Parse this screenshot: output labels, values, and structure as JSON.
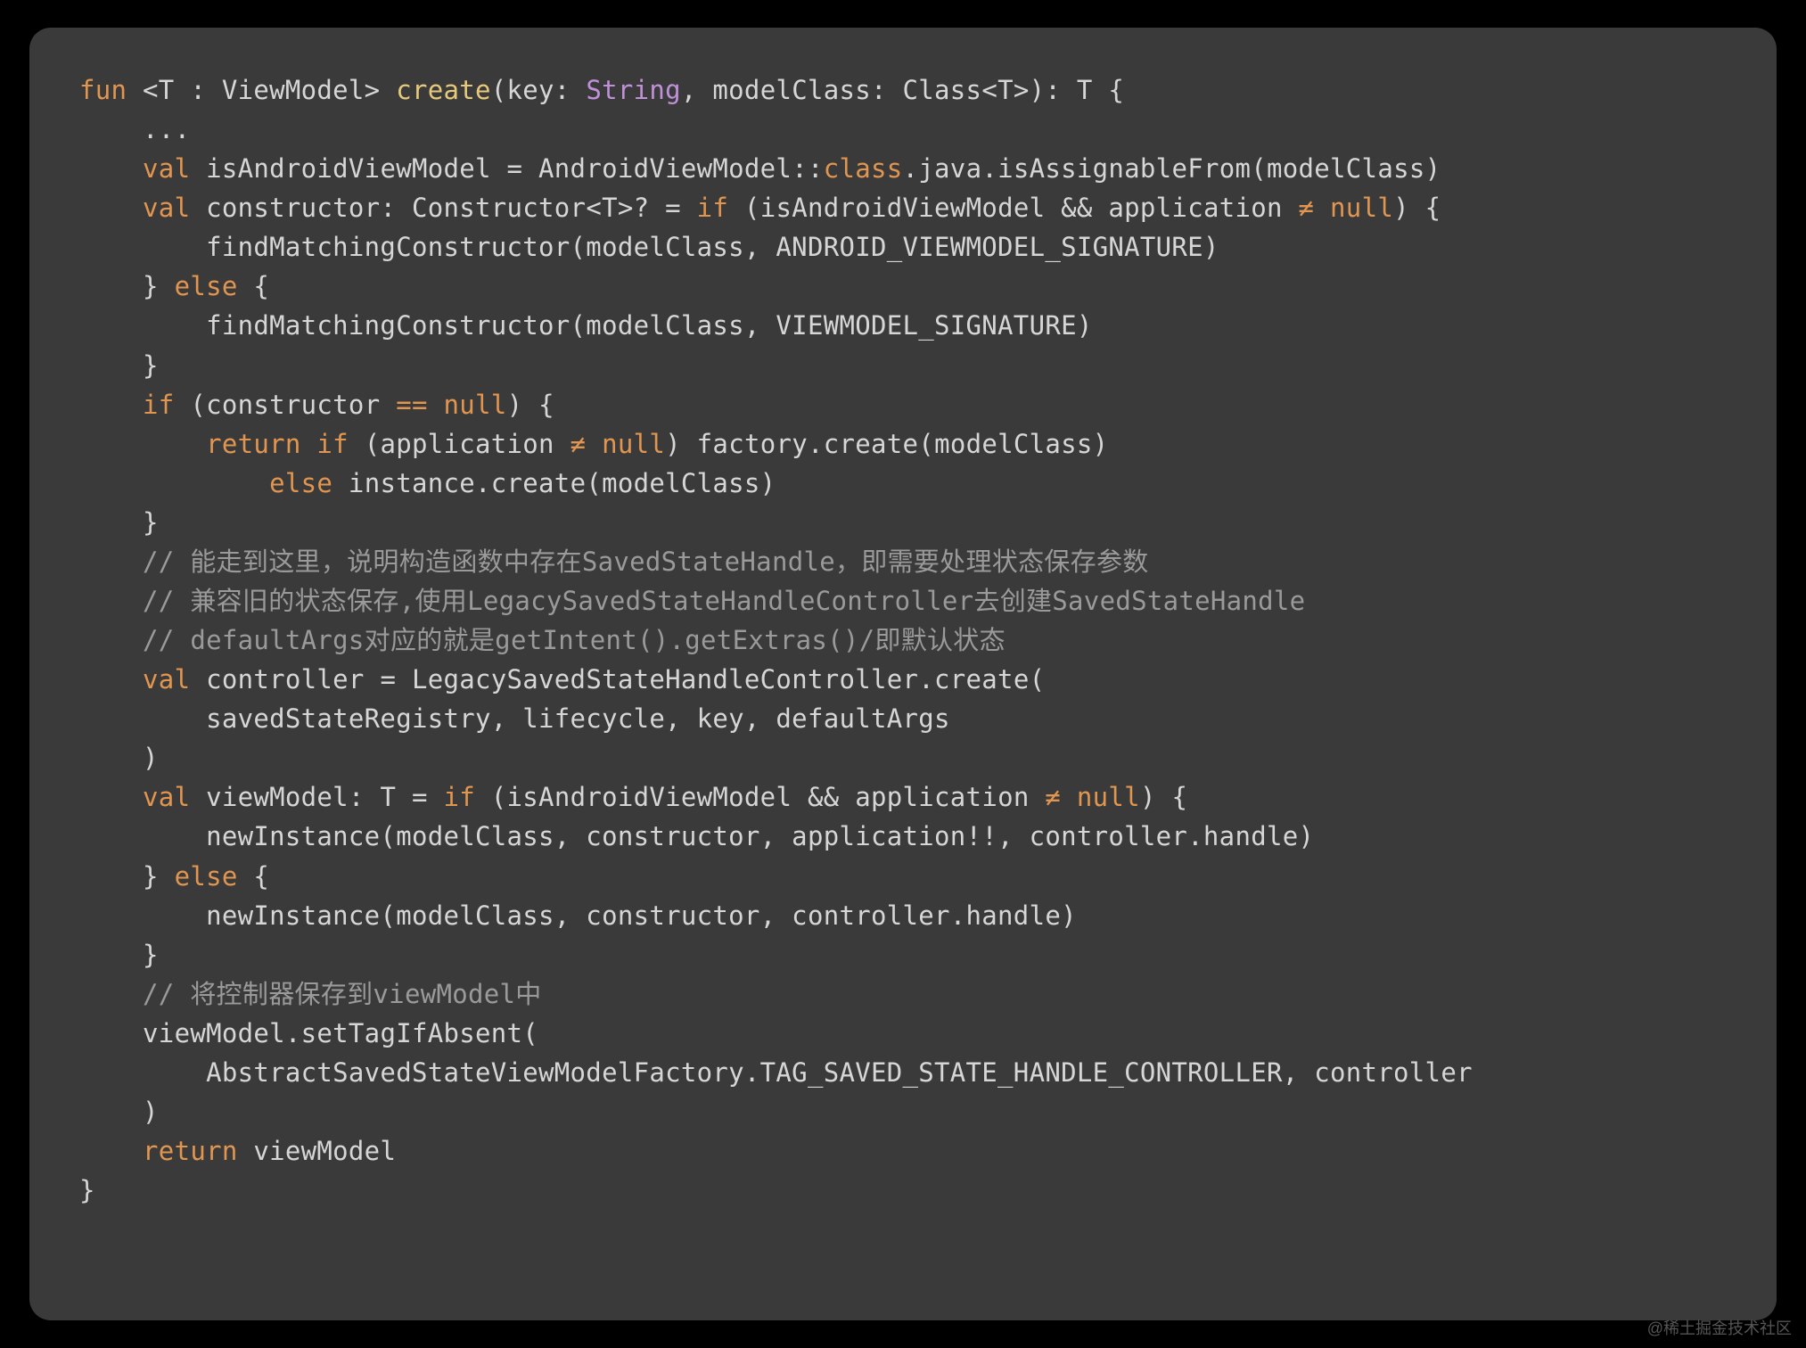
{
  "watermark": "@稀土掘金技术社区",
  "code": {
    "lines": [
      {
        "indent": 0,
        "tokens": [
          {
            "t": "kw",
            "v": "fun"
          },
          {
            "t": "plain",
            "v": " <T : ViewModel> "
          },
          {
            "t": "fn",
            "v": "create"
          },
          {
            "t": "plain",
            "v": "(key: "
          },
          {
            "t": "type",
            "v": "String"
          },
          {
            "t": "plain",
            "v": ", modelClass: Class<T>): T {"
          }
        ]
      },
      {
        "indent": 1,
        "tokens": [
          {
            "t": "plain",
            "v": "..."
          }
        ]
      },
      {
        "indent": 1,
        "tokens": [
          {
            "t": "kw",
            "v": "val"
          },
          {
            "t": "plain",
            "v": " isAndroidViewModel = AndroidViewModel::"
          },
          {
            "t": "cls",
            "v": "class"
          },
          {
            "t": "plain",
            "v": ".java.isAssignableFrom(modelClass)"
          }
        ]
      },
      {
        "indent": 1,
        "tokens": [
          {
            "t": "kw",
            "v": "val"
          },
          {
            "t": "plain",
            "v": " constructor: Constructor<T>? = "
          },
          {
            "t": "kw",
            "v": "if"
          },
          {
            "t": "plain",
            "v": " (isAndroidViewModel && application "
          },
          {
            "t": "op",
            "v": "≠"
          },
          {
            "t": "plain",
            "v": " "
          },
          {
            "t": "null",
            "v": "null"
          },
          {
            "t": "plain",
            "v": ") {"
          }
        ]
      },
      {
        "indent": 2,
        "tokens": [
          {
            "t": "plain",
            "v": "findMatchingConstructor(modelClass, ANDROID_VIEWMODEL_SIGNATURE)"
          }
        ]
      },
      {
        "indent": 1,
        "tokens": [
          {
            "t": "plain",
            "v": "} "
          },
          {
            "t": "kw",
            "v": "else"
          },
          {
            "t": "plain",
            "v": " {"
          }
        ]
      },
      {
        "indent": 2,
        "tokens": [
          {
            "t": "plain",
            "v": "findMatchingConstructor(modelClass, VIEWMODEL_SIGNATURE)"
          }
        ]
      },
      {
        "indent": 1,
        "tokens": [
          {
            "t": "plain",
            "v": "}"
          }
        ]
      },
      {
        "indent": 1,
        "tokens": [
          {
            "t": "kw",
            "v": "if"
          },
          {
            "t": "plain",
            "v": " (constructor "
          },
          {
            "t": "op",
            "v": "=="
          },
          {
            "t": "plain",
            "v": " "
          },
          {
            "t": "null",
            "v": "null"
          },
          {
            "t": "plain",
            "v": ") {"
          }
        ]
      },
      {
        "indent": 2,
        "tokens": [
          {
            "t": "kw",
            "v": "return"
          },
          {
            "t": "plain",
            "v": " "
          },
          {
            "t": "kw",
            "v": "if"
          },
          {
            "t": "plain",
            "v": " (application "
          },
          {
            "t": "op",
            "v": "≠"
          },
          {
            "t": "plain",
            "v": " "
          },
          {
            "t": "null",
            "v": "null"
          },
          {
            "t": "plain",
            "v": ") factory.create(modelClass)"
          }
        ]
      },
      {
        "indent": 3,
        "tokens": [
          {
            "t": "kw",
            "v": "else"
          },
          {
            "t": "plain",
            "v": " instance.create(modelClass)"
          }
        ]
      },
      {
        "indent": 1,
        "tokens": [
          {
            "t": "plain",
            "v": "}"
          }
        ]
      },
      {
        "indent": 1,
        "tokens": [
          {
            "t": "comment",
            "v": "// 能走到这里，说明构造函数中存在SavedStateHandle，即需要处理状态保存参数"
          }
        ]
      },
      {
        "indent": 1,
        "tokens": [
          {
            "t": "comment",
            "v": "// 兼容旧的状态保存,使用LegacySavedStateHandleController去创建SavedStateHandle"
          }
        ]
      },
      {
        "indent": 1,
        "tokens": [
          {
            "t": "comment",
            "v": "// defaultArgs对应的就是getIntent().getExtras()/即默认状态"
          }
        ]
      },
      {
        "indent": 1,
        "tokens": [
          {
            "t": "kw",
            "v": "val"
          },
          {
            "t": "plain",
            "v": " controller = LegacySavedStateHandleController.create("
          }
        ]
      },
      {
        "indent": 2,
        "tokens": [
          {
            "t": "plain",
            "v": "savedStateRegistry, lifecycle, key, defaultArgs"
          }
        ]
      },
      {
        "indent": 1,
        "tokens": [
          {
            "t": "plain",
            "v": ")"
          }
        ]
      },
      {
        "indent": 1,
        "tokens": [
          {
            "t": "kw",
            "v": "val"
          },
          {
            "t": "plain",
            "v": " viewModel: T = "
          },
          {
            "t": "kw",
            "v": "if"
          },
          {
            "t": "plain",
            "v": " (isAndroidViewModel && application "
          },
          {
            "t": "op",
            "v": "≠"
          },
          {
            "t": "plain",
            "v": " "
          },
          {
            "t": "null",
            "v": "null"
          },
          {
            "t": "plain",
            "v": ") {"
          }
        ]
      },
      {
        "indent": 2,
        "tokens": [
          {
            "t": "plain",
            "v": "newInstance(modelClass, constructor, application!!, controller.handle)"
          }
        ]
      },
      {
        "indent": 1,
        "tokens": [
          {
            "t": "plain",
            "v": "} "
          },
          {
            "t": "kw",
            "v": "else"
          },
          {
            "t": "plain",
            "v": " {"
          }
        ]
      },
      {
        "indent": 2,
        "tokens": [
          {
            "t": "plain",
            "v": "newInstance(modelClass, constructor, controller.handle)"
          }
        ]
      },
      {
        "indent": 1,
        "tokens": [
          {
            "t": "plain",
            "v": "}"
          }
        ]
      },
      {
        "indent": 1,
        "tokens": [
          {
            "t": "comment",
            "v": "// 将控制器保存到viewModel中"
          }
        ]
      },
      {
        "indent": 1,
        "tokens": [
          {
            "t": "plain",
            "v": "viewModel.setTagIfAbsent("
          }
        ]
      },
      {
        "indent": 2,
        "tokens": [
          {
            "t": "plain",
            "v": "AbstractSavedStateViewModelFactory.TAG_SAVED_STATE_HANDLE_CONTROLLER, controller"
          }
        ]
      },
      {
        "indent": 1,
        "tokens": [
          {
            "t": "plain",
            "v": ")"
          }
        ]
      },
      {
        "indent": 1,
        "tokens": [
          {
            "t": "kw",
            "v": "return"
          },
          {
            "t": "plain",
            "v": " viewModel"
          }
        ]
      },
      {
        "indent": 0,
        "tokens": [
          {
            "t": "plain",
            "v": "}"
          }
        ]
      }
    ]
  }
}
